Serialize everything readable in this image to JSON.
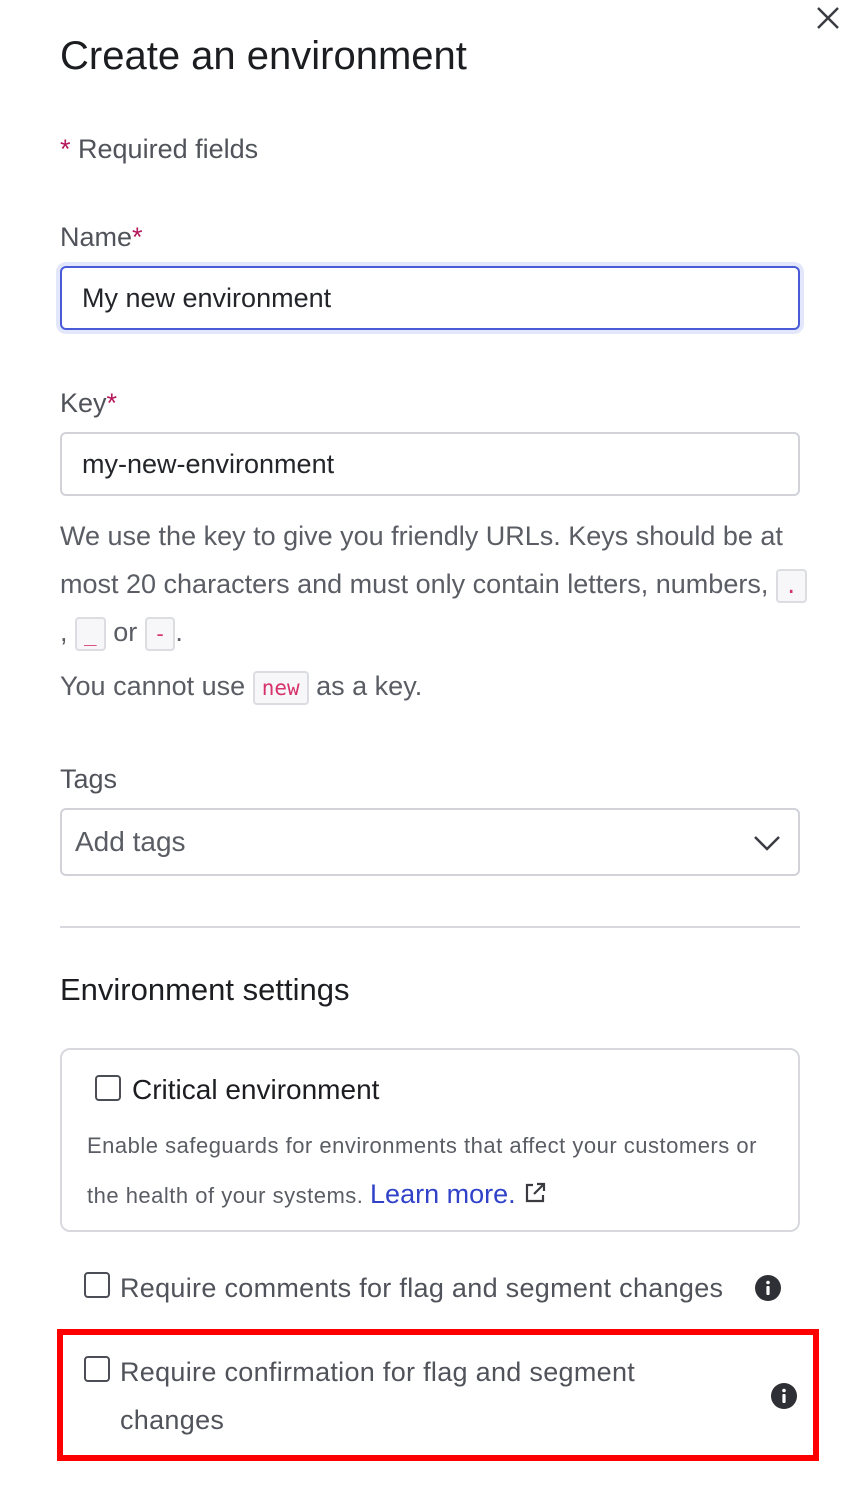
{
  "dialog": {
    "title": "Create an environment",
    "close_icon": "close-icon"
  },
  "required_note": {
    "star": "*",
    "text": "Required fields"
  },
  "name_field": {
    "label": "Name",
    "required_star": "*",
    "value": "My new environment"
  },
  "key_field": {
    "label": "Key",
    "required_star": "*",
    "value": "my-new-environment",
    "help_text_1": "We use the key to give you friendly URLs. Keys should be at most 20 characters and must only contain letters, numbers,",
    "code_dot": ".",
    "comma": ",",
    "code_underscore": "_",
    "or_text": "or",
    "code_dash": "-",
    "period": ".",
    "help_text_2_prefix": "You cannot use",
    "code_new": "new",
    "help_text_2_suffix": "as a key."
  },
  "tags_field": {
    "label": "Tags",
    "placeholder": "Add tags",
    "icon": "chevron-down-icon"
  },
  "environment_settings": {
    "title": "Environment settings",
    "critical": {
      "label": "Critical environment",
      "description": "Enable safeguards for environments that affect your customers or the health of your systems.",
      "link_text": "Learn more.",
      "link_icon": "external-link-icon",
      "checked": false
    },
    "require_comments": {
      "label": "Require comments for flag and segment changes",
      "icon": "info-icon",
      "checked": false
    },
    "require_confirmation": {
      "label": "Require confirmation for flag and segment changes",
      "icon": "info-icon",
      "checked": false
    }
  },
  "colors": {
    "accent": "#4a5bd8",
    "required": "#b5175a",
    "link": "#3142c9",
    "code": "#d6336c",
    "highlight": "#ff0000"
  }
}
